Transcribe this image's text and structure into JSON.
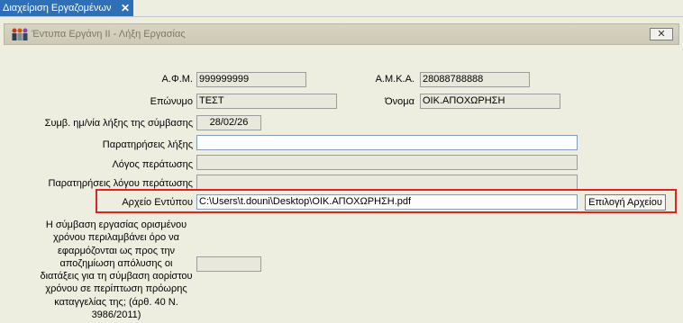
{
  "tab": {
    "label": "Διαχείριση Εργαζομένων",
    "close": "✕"
  },
  "window": {
    "title": "Έντυπα Εργάνη ΙΙ - Λήξη Εργασίας",
    "close": "✕"
  },
  "form": {
    "afm_label": "Α.Φ.Μ.",
    "afm_value": "999999999",
    "amka_label": "Α.Μ.Κ.Α.",
    "amka_value": "28088788888",
    "surname_label": "Επώνυμο",
    "surname_value": "ΤΕΣΤ",
    "name_label": "Όνομα",
    "name_value": "ΟΙΚ.ΑΠΟΧΩΡΗΣΗ",
    "end_date_label": "Συμβ. ημ/νία λήξης της σύμβασης",
    "end_date_value": "28/02/26",
    "end_notes_label": "Παρατηρήσεις λήξης",
    "end_notes_value": "",
    "reason_label": "Λόγος περάτωσης",
    "reason_value": "",
    "reason_notes_label": "Παρατηρήσεις λόγου περάτωσης",
    "reason_notes_value": "",
    "file_label": "Αρχείο Εντύπου",
    "file_value": "C:\\Users\\t.douni\\Desktop\\ΟΙΚ.ΑΠΟΧΩΡΗΣΗ.pdf",
    "file_button": "Επιλογή Αρχείου",
    "clause_text": "Η σύμβαση εργασίας ορισμένου χρόνου περιλαμβάνει όρο να εφαρμόζονται ως προς την αποζημίωση απόλυσης οι διατάξεις για τη σύμβαση αορίστου χρόνου σε περίπτωση πρόωρης καταγγελίας της; (άρθ. 40 Ν. 3986/2011)",
    "clause_value": ""
  }
}
